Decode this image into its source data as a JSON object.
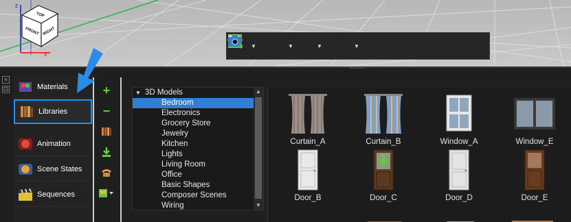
{
  "view_cube": {
    "top": "TOP",
    "front": "FRONT",
    "right": "RIGHT",
    "axis_z": "Z",
    "axis_x": "X"
  },
  "toolbar": {
    "buttons": [
      "select-view-icon",
      "floor-grid-icon",
      "solid-box-icon",
      "pointer-icon",
      "fit-view-icon",
      "zoom-icon",
      "texture-plane-icon",
      "grid-icon",
      "camera-icon"
    ]
  },
  "categories": [
    {
      "label": "Materials",
      "icon": "materials-icon",
      "color": "#9b59b6"
    },
    {
      "label": "Libraries",
      "icon": "libraries-icon",
      "color": "#c98a3e"
    },
    {
      "label": "Animation",
      "icon": "animation-icon",
      "color": "#e24b3b"
    },
    {
      "label": "Scene States",
      "icon": "scene-states-icon",
      "color": "#e8a23a"
    },
    {
      "label": "Sequences",
      "icon": "sequences-icon",
      "color": "#e0c13a"
    }
  ],
  "tools": [
    "add-icon",
    "remove-icon",
    "library-icon",
    "import-icon",
    "phone-icon",
    "view-options-icon"
  ],
  "tree": {
    "root": "3D Models",
    "items": [
      "Bedroom",
      "Electronics",
      "Grocery Store",
      "Jewelry",
      "Kitchen",
      "Lights",
      "Living Room",
      "Office",
      "Basic Shapes",
      "Composer Scenes",
      "Wiring"
    ],
    "selected_index": 0
  },
  "thumbnails": [
    {
      "label": "Curtain_A",
      "kind": "curtain",
      "color": "#9d8f88"
    },
    {
      "label": "Curtain_B",
      "kind": "curtain",
      "color": "#7fa0c4"
    },
    {
      "label": "Window_A",
      "kind": "window",
      "color": "#e8e8e8"
    },
    {
      "label": "Window_E",
      "kind": "window",
      "color": "#3b3b3b"
    },
    {
      "label": "Door_B",
      "kind": "door",
      "color": "#e9e9e9"
    },
    {
      "label": "Door_C",
      "kind": "door",
      "color": "#5a3a22"
    },
    {
      "label": "Door_D",
      "kind": "door",
      "color": "#e3e3e3"
    },
    {
      "label": "Door_E",
      "kind": "door",
      "color": "#6b3b1f"
    }
  ],
  "colors": {
    "accent": "#1e90ff",
    "selection": "#2f7fd7",
    "arrow": "#2a8ce6"
  }
}
